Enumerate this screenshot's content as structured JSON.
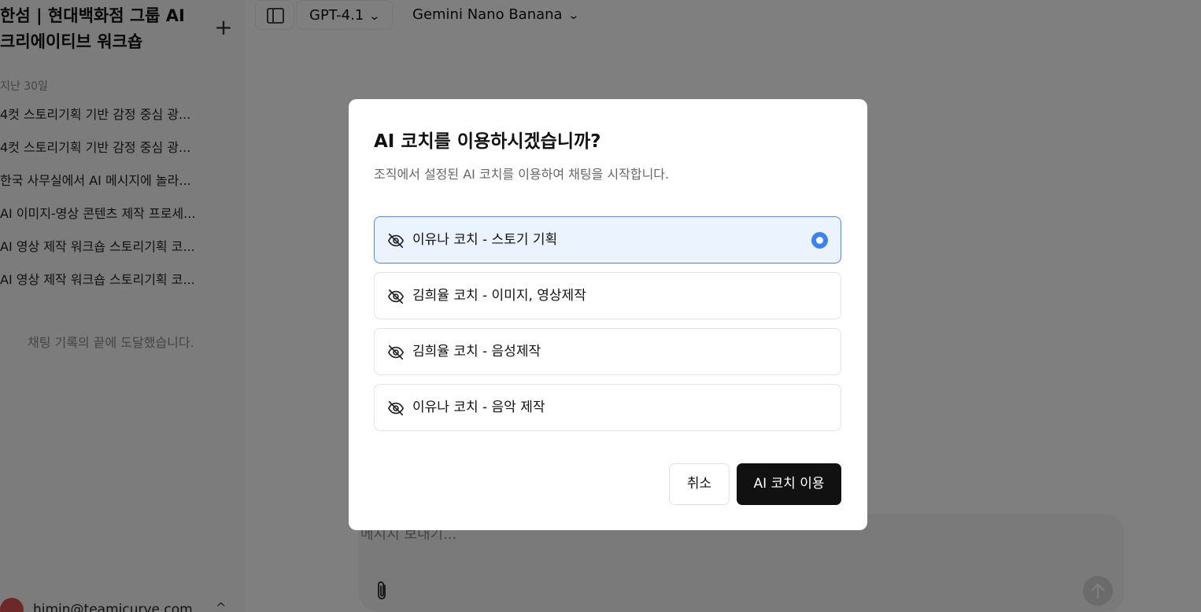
{
  "sidebar": {
    "workspace_title": "한섬 | 현대백화점 그룹 AI 크리에이티브 워크숍",
    "new_chat_icon": "plus-icon",
    "section_label": "지난 30일",
    "chats": [
      "4컷 스토리기획 기반 감정 중심 광...",
      "4컷 스토리기획 기반 감정 중심 광...",
      "한국 사무실에서 AI 메시지에 놀라...",
      "AI 이미지-영상 콘텐츠 제작 프로세...",
      "AI 영상 제작 워크숍 스토리기획 코...",
      "AI 영상 제작 워크숍 스토리기획 코..."
    ],
    "end_message": "채팅 기록의 끝에 도달했습니다.",
    "user_email": "himin@teamicurve.com"
  },
  "topbar": {
    "panel_icon": "sidebar-toggle-icon",
    "model_primary": "GPT-4.1",
    "model_secondary": "Gemini Nano Banana"
  },
  "composer": {
    "placeholder": "메시지 보내기...",
    "attach_icon": "paperclip-icon",
    "send_icon": "arrow-up-icon"
  },
  "modal": {
    "title": "AI 코치를 이용하시겠습니까?",
    "description": "조직에서 설정된 AI 코치를 이용하여 채팅을 시작합니다.",
    "coaches": [
      {
        "label": "이유나 코치 - 스토기 기획",
        "selected": true,
        "icon": "eye-off-icon"
      },
      {
        "label": "김희율 코치 - 이미지, 영상제작",
        "selected": false,
        "icon": "eye-off-icon"
      },
      {
        "label": "김희율 코치 - 음성제작",
        "selected": false,
        "icon": "eye-off-icon"
      },
      {
        "label": "이유나 코치 - 음악 제작",
        "selected": false,
        "icon": "eye-off-icon"
      }
    ],
    "cancel_label": "취소",
    "confirm_label": "AI 코치 이용"
  },
  "colors": {
    "accent": "#3b82f6",
    "selected_bg": "#ebf3ff",
    "primary_button": "#111111",
    "overlay": "rgba(0,0,0,0.5)"
  }
}
